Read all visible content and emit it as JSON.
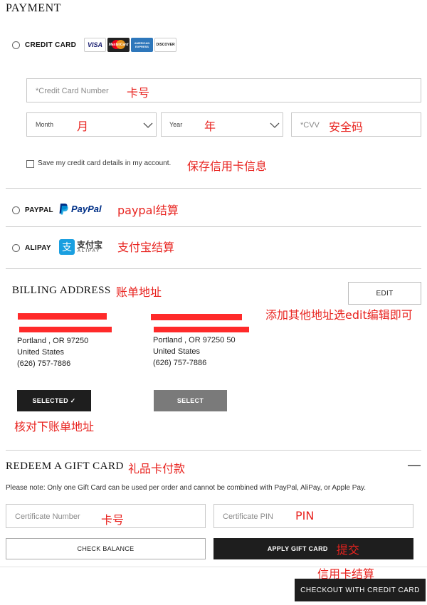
{
  "payment": {
    "title": "PAYMENT",
    "credit_card": {
      "label": "CREDIT CARD",
      "card_logos": [
        "VISA",
        "MasterCard",
        "AMERICAN EXPRESS",
        "DISCOVER"
      ],
      "number_placeholder": "*Credit Card Number",
      "number_note": "卡号",
      "month_placeholder": "Month",
      "month_note": "月",
      "year_placeholder": "Year",
      "year_note": "年",
      "cvv_placeholder": "*CVV",
      "cvv_note": "安全码",
      "save_label": "Save my credit card details in my account.",
      "save_note": "保存信用卡信息"
    },
    "paypal": {
      "label": "PAYPAL",
      "brand": "PayPal",
      "note": "paypal结算"
    },
    "alipay": {
      "label": "ALIPAY",
      "brand_cn": "支付宝",
      "brand_en": "ALIPAY",
      "note": "支付宝结算"
    }
  },
  "billing": {
    "title": "BILLING ADDRESS",
    "title_note": "账单地址",
    "edit_label": "EDIT",
    "edit_note": "添加其他地址选edit编辑即可",
    "addresses": [
      {
        "city": "Portland , OR 97250",
        "country": "United States",
        "phone": "(626) 757-7886",
        "button": "SELECTED ✓"
      },
      {
        "city": "Portland , OR 97250 50",
        "country": "United States",
        "phone": "(626) 757-7886",
        "button": "SELECT"
      }
    ],
    "verify_note": "核对下账单地址"
  },
  "gift": {
    "title": "REDEEM A GIFT CARD",
    "title_note": "礼品卡付款",
    "collapse_symbol": "—",
    "note": "Please note: Only one Gift Card can be used per order and cannot be combined with PayPal, AliPay, or Apple Pay.",
    "cert_placeholder": "Certificate Number",
    "cert_note": "卡号",
    "pin_placeholder": "Certificate PIN",
    "pin_note": "PIN",
    "check_label": "CHECK BALANCE",
    "apply_label": "APPLY GIFT CARD",
    "apply_note": "提交"
  },
  "checkout": {
    "label": "CHECKOUT WITH CREDIT CARD",
    "note": "信用卡结算"
  },
  "colors": {
    "annotation": "#e8231f",
    "dark_button": "#1e1e1e",
    "gray_button": "#7a7a7a",
    "paypal_dark": "#003087",
    "paypal_light": "#009cde",
    "alipay_blue": "#1a9fe0"
  }
}
